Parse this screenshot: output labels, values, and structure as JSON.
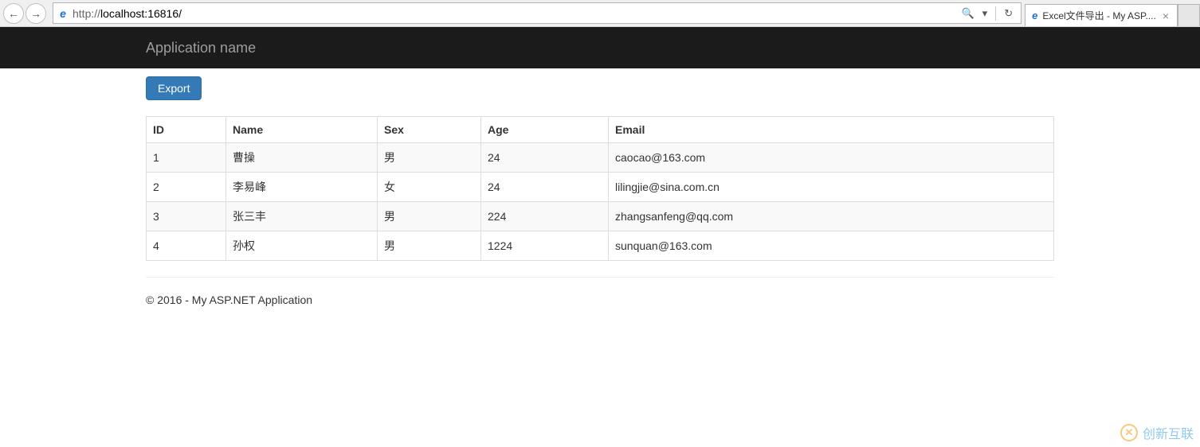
{
  "browser": {
    "url_prefix": "http://",
    "url_host": "localhost:",
    "url_port_path": "16816/",
    "tab_title": "Excel文件导出 - My ASP....",
    "search_glyph": "🔍",
    "dropdown_glyph": "▾",
    "refresh_glyph": "↻",
    "back_glyph": "←",
    "fwd_glyph": "→",
    "close_glyph": "×",
    "ie_glyph": "e"
  },
  "navbar": {
    "brand": "Application name"
  },
  "actions": {
    "export_label": "Export"
  },
  "table": {
    "headers": {
      "id": "ID",
      "name": "Name",
      "sex": "Sex",
      "age": "Age",
      "email": "Email"
    },
    "rows": [
      {
        "id": "1",
        "name": "曹操",
        "sex": "男",
        "age": "24",
        "email": "caocao@163.com"
      },
      {
        "id": "2",
        "name": "李易峰",
        "sex": "女",
        "age": "24",
        "email": "lilingjie@sina.com.cn"
      },
      {
        "id": "3",
        "name": "张三丰",
        "sex": "男",
        "age": "224",
        "email": "zhangsanfeng@qq.com"
      },
      {
        "id": "4",
        "name": "孙权",
        "sex": "男",
        "age": "1224",
        "email": "sunquan@163.com"
      }
    ]
  },
  "footer": {
    "text": "© 2016 - My ASP.NET Application"
  },
  "watermark": {
    "text": "创新互联"
  }
}
